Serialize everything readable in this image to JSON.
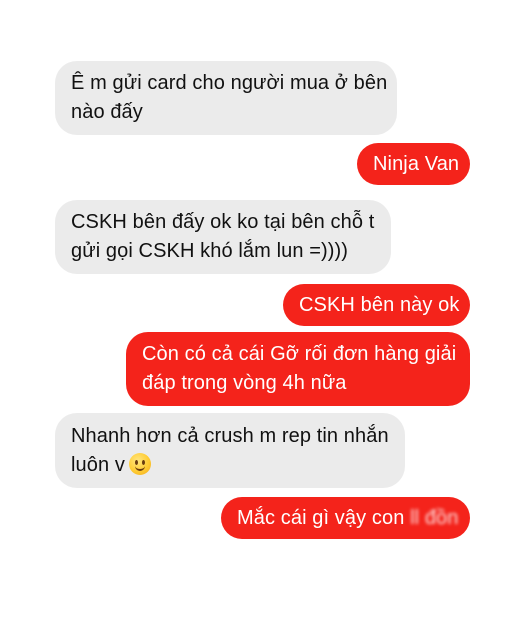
{
  "messages": [
    {
      "direction": "incoming",
      "lines": [
        "Ê m gửi card cho người mua ở bên",
        "nào đấy"
      ]
    },
    {
      "direction": "outgoing",
      "lines": [
        "Ninja Van"
      ]
    },
    {
      "direction": "incoming",
      "lines": [
        "CSKH bên đấy ok ko tại bên chỗ t",
        "gửi gọi CSKH khó lắm lun =))))"
      ]
    },
    {
      "direction": "outgoing",
      "lines": [
        "CSKH bên này ok"
      ]
    },
    {
      "direction": "outgoing",
      "lines": [
        "Còn có cả cái Gỡ rối đơn hàng giải",
        "đáp trong vòng 4h nữa"
      ]
    },
    {
      "direction": "incoming",
      "lines": [
        "Nhanh hơn cả crush m rep tin nhắn",
        "luôn v"
      ],
      "emoji": "slightly-smiling-face-icon"
    },
    {
      "direction": "outgoing",
      "text": "Mắc cái gì vậy con ",
      "blurred_text": "ll đồn"
    }
  ],
  "colors": {
    "incoming_bg": "#ebebeb",
    "outgoing_bg": "#f4231b",
    "incoming_text": "#111111",
    "outgoing_text": "#ffffff"
  }
}
